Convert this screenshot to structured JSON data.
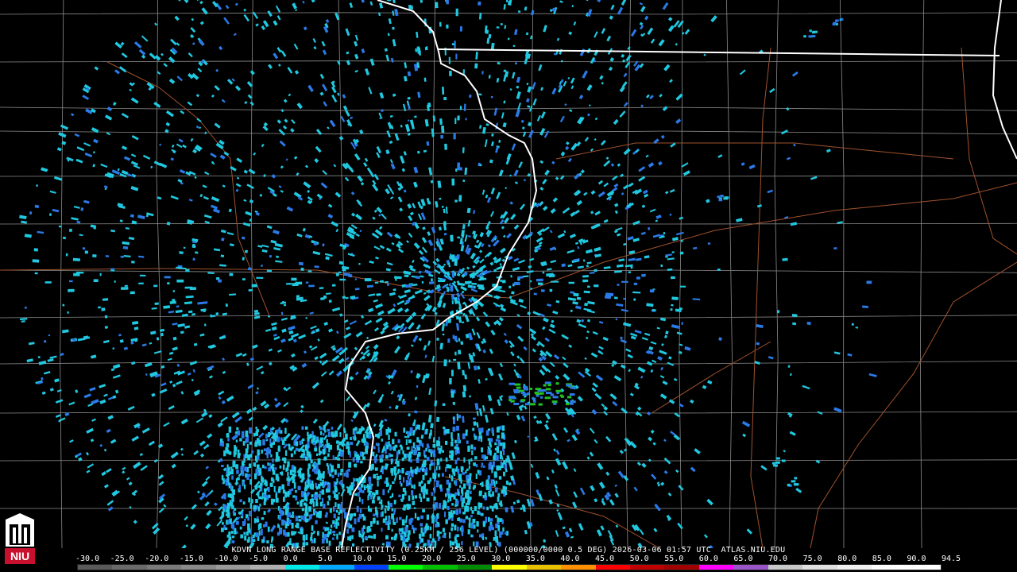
{
  "caption": "KDVN LONG RANGE BASE REFLECTIVITY (0.25KM / 256 LEVEL) (000000/0000 0.5 DEG) 2026-03-06 01:57 UTC  ATLAS.NIU.EDU",
  "logo_text": "NIU",
  "scale": {
    "labels": [
      "-30.0",
      "-25.0",
      "-20.0",
      "-15.0",
      "-10.0",
      "-5.0",
      "0.0",
      "5.0",
      "10.0",
      "15.0",
      "20.0",
      "25.0",
      "30.0",
      "35.0",
      "40.0",
      "45.0",
      "50.0",
      "55.0",
      "60.0",
      "65.0",
      "70.0",
      "75.0",
      "80.0",
      "85.0",
      "90.0",
      "94.5"
    ],
    "colors": [
      "#5a5a5a",
      "#6a6a6a",
      "#7a7a7a",
      "#8a8a8a",
      "#9a9a9a",
      "#b0b0b0",
      "#00e8e8",
      "#00a8ff",
      "#0040ff",
      "#00ff00",
      "#00c000",
      "#008c00",
      "#ffff00",
      "#e8c000",
      "#ff9000",
      "#ff0000",
      "#c00000",
      "#a00000",
      "#ff00ff",
      "#9955c8",
      "#c8c8c8",
      "#e0e0e0",
      "#f0f0f0",
      "#ffffff",
      "#ffffff"
    ]
  },
  "colors": {
    "background": "#000000",
    "state_border": "#ffffff",
    "county_line": "#8c8c8c",
    "highway": "#a0522d",
    "echo_cyan": "#20c8e0",
    "echo_blue": "#2a7ae8",
    "echo_green": "#22c020"
  }
}
